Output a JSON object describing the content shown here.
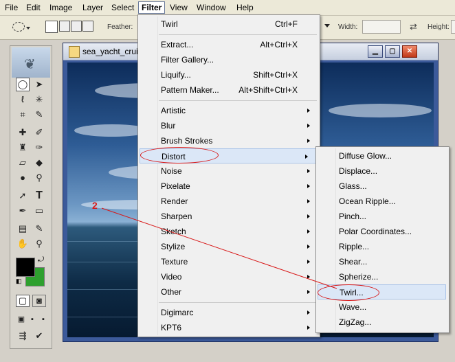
{
  "menubar": {
    "items": [
      "File",
      "Edit",
      "Image",
      "Layer",
      "Select",
      "Filter",
      "View",
      "Window",
      "Help"
    ],
    "open_item": "Filter"
  },
  "options_bar": {
    "feather_label": "Feather:",
    "width_label": "Width:",
    "height_label": "Height:"
  },
  "document": {
    "title": "sea_yacht_cruis",
    "buttons": [
      "minimize",
      "maximize",
      "close"
    ]
  },
  "filter_menu": {
    "items": [
      {
        "label": "Twirl",
        "shortcut": "Ctrl+F"
      },
      {
        "label": "Extract...",
        "shortcut": "Alt+Ctrl+X"
      },
      {
        "label": "Filter Gallery...",
        "shortcut": ""
      },
      {
        "label": "Liquify...",
        "shortcut": "Shift+Ctrl+X"
      },
      {
        "label": "Pattern Maker...",
        "shortcut": "Alt+Shift+Ctrl+X"
      },
      {
        "label": "Artistic",
        "submenu": true
      },
      {
        "label": "Blur",
        "submenu": true
      },
      {
        "label": "Brush Strokes",
        "submenu": true
      },
      {
        "label": "Distort",
        "submenu": true,
        "highlighted": true
      },
      {
        "label": "Noise",
        "submenu": true
      },
      {
        "label": "Pixelate",
        "submenu": true
      },
      {
        "label": "Render",
        "submenu": true
      },
      {
        "label": "Sharpen",
        "submenu": true
      },
      {
        "label": "Sketch",
        "submenu": true
      },
      {
        "label": "Stylize",
        "submenu": true
      },
      {
        "label": "Texture",
        "submenu": true
      },
      {
        "label": "Video",
        "submenu": true
      },
      {
        "label": "Other",
        "submenu": true
      },
      {
        "label": "Digimarc",
        "submenu": true
      },
      {
        "label": "KPT6",
        "submenu": true
      }
    ]
  },
  "distort_submenu": {
    "items": [
      "Diffuse Glow...",
      "Displace...",
      "Glass...",
      "Ocean Ripple...",
      "Pinch...",
      "Polar Coordinates...",
      "Ripple...",
      "Shear...",
      "Spherize...",
      "Twirl...",
      "Wave...",
      "ZigZag..."
    ],
    "highlighted": "Twirl..."
  },
  "annotation": {
    "step_number": "2",
    "color": "#d81818"
  },
  "colors": {
    "foreground": "#000000",
    "background": "#2ea02e"
  },
  "icons": {
    "tools": [
      "marquee-tool-icon",
      "move-tool-icon",
      "lasso-tool-icon",
      "magic-wand-icon",
      "crop-tool-icon",
      "slice-tool-icon",
      "healing-brush-icon",
      "brush-tool-icon",
      "clone-stamp-icon",
      "history-brush-icon",
      "eraser-tool-icon",
      "paint-bucket-icon",
      "blur-tool-icon",
      "dodge-tool-icon",
      "path-selection-icon",
      "type-tool-icon",
      "pen-tool-icon",
      "shape-tool-icon",
      "notes-tool-icon",
      "eyedropper-icon",
      "hand-tool-icon",
      "zoom-tool-icon"
    ]
  }
}
